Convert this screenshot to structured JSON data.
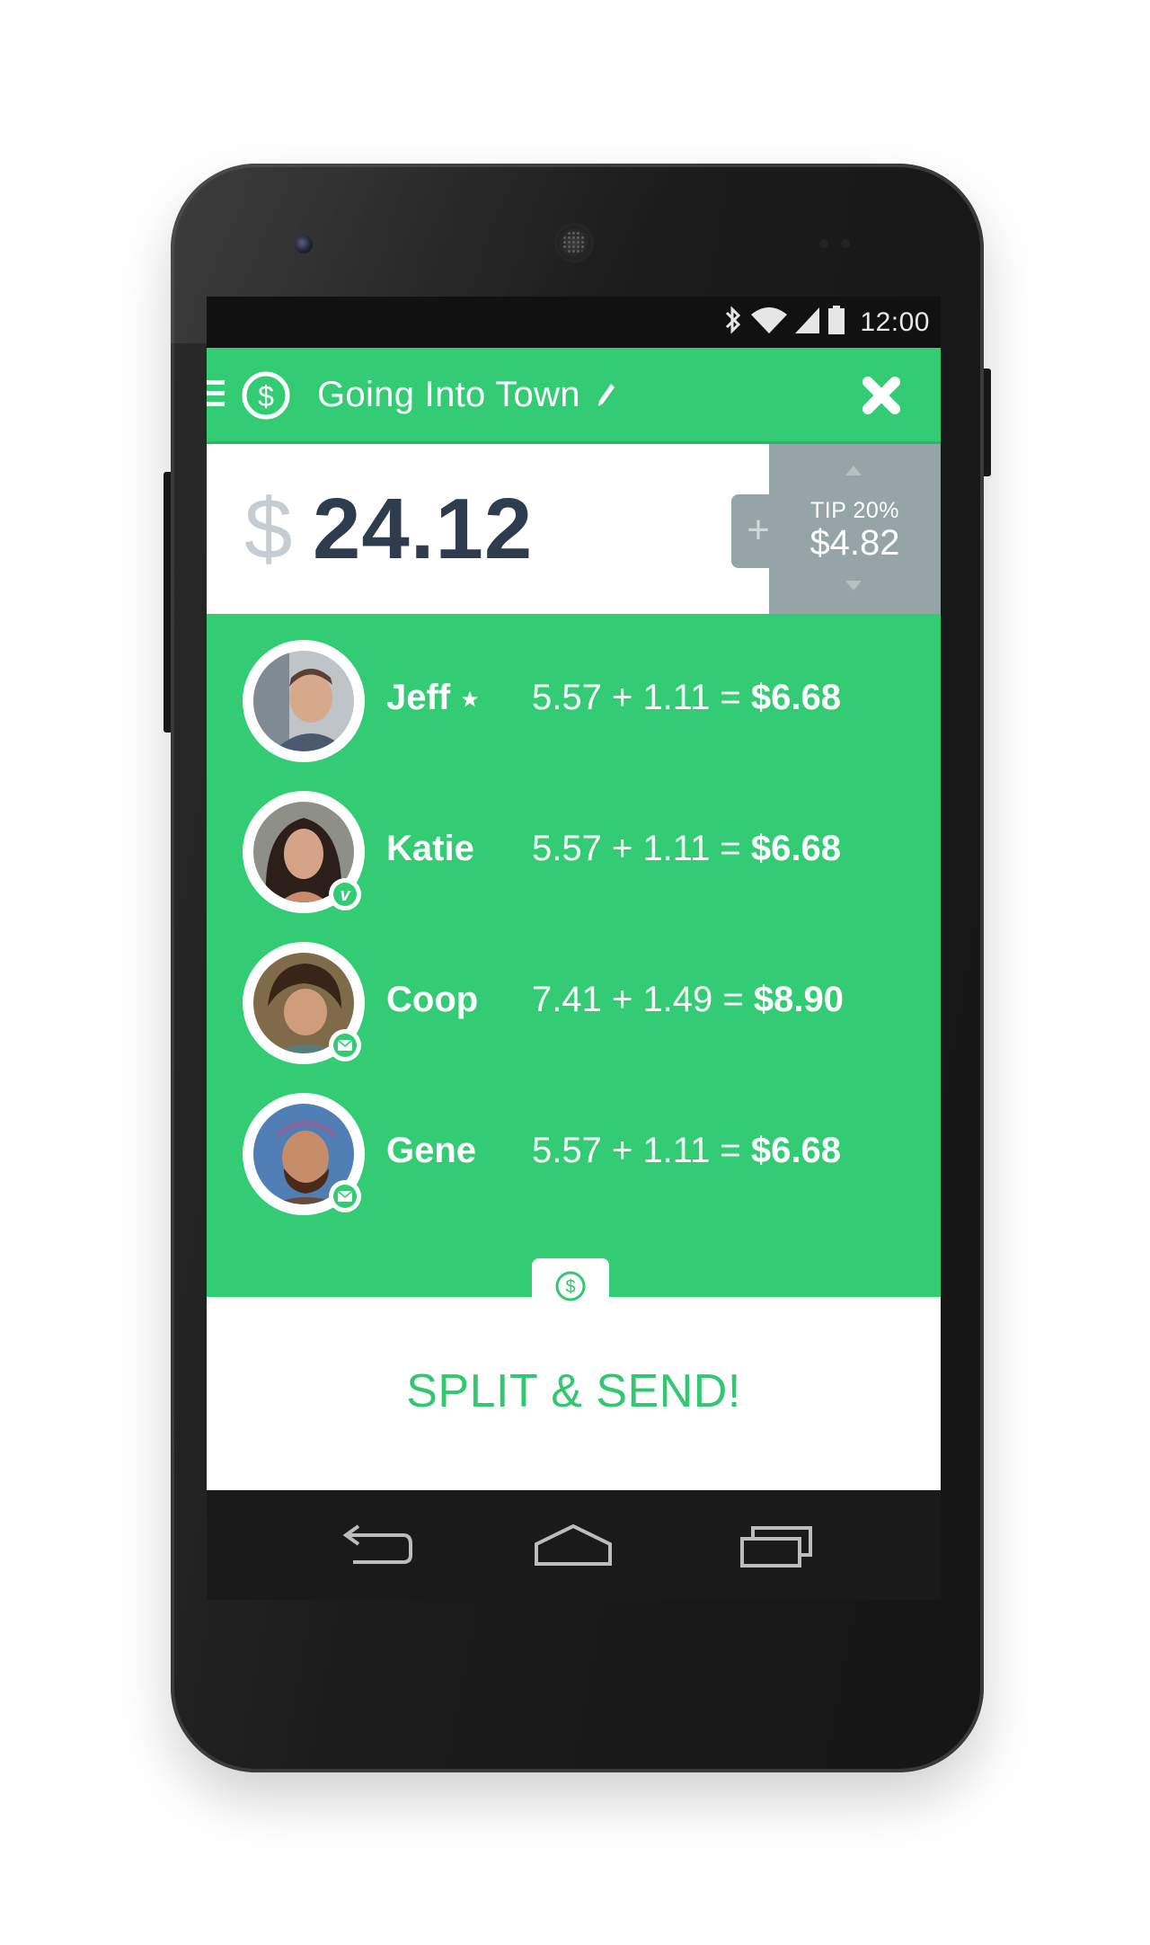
{
  "statusbar": {
    "time": "12:00",
    "icons": [
      "bluetooth-icon",
      "wifi-icon",
      "signal-icon",
      "battery-icon"
    ]
  },
  "appbar": {
    "title": "Going Into Town",
    "icons": [
      "menu-icon",
      "dollar-logo-icon",
      "edit-icon",
      "close-icon"
    ]
  },
  "bill": {
    "currency_symbol": "$",
    "amount": "24.12"
  },
  "tip": {
    "label": "TIP 20%",
    "amount": "$4.82",
    "add_symbol": "+"
  },
  "people": [
    {
      "name": "Jeff",
      "calc": "5.57 + 1.11 = ",
      "total": "$6.68",
      "badge": "star-icon"
    },
    {
      "name": "Katie",
      "calc": "5.57 + 1.11 = ",
      "total": "$6.68",
      "badge": "venmo-icon"
    },
    {
      "name": "Coop",
      "calc": "7.41 + 1.49 = ",
      "total": "$8.90",
      "badge": "mail-icon"
    },
    {
      "name": "Gene",
      "calc": "5.57 + 1.11 = ",
      "total": "$6.68",
      "badge": "mail-icon"
    }
  ],
  "actions": {
    "split_send_label": "SPLIT & SEND!"
  },
  "navbar": {
    "icons": [
      "back-icon",
      "home-icon",
      "recents-icon"
    ]
  },
  "colors": {
    "accent": "#33cc74",
    "amount_text": "#2f3c4e",
    "tip_panel": "#95a4a7",
    "send_text": "#33c771"
  }
}
